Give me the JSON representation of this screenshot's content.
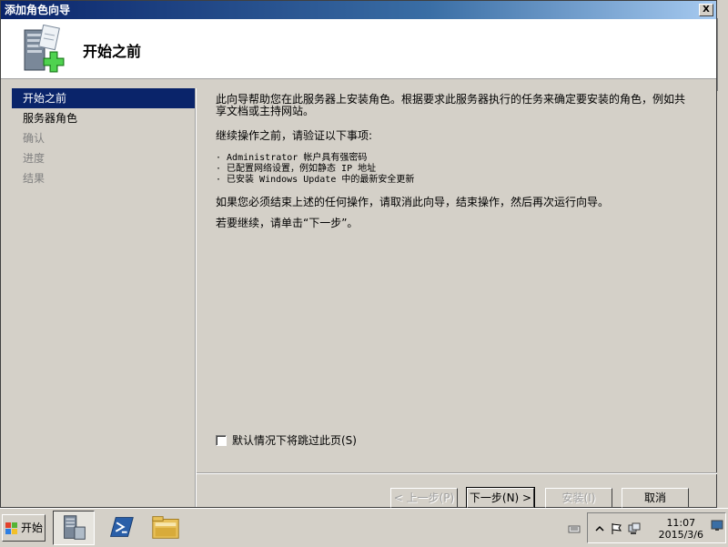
{
  "window": {
    "title": "添加角色向导",
    "close_label": "X"
  },
  "header": {
    "title": "开始之前",
    "icon": "server-add-icon"
  },
  "nav": {
    "items": [
      {
        "label": "开始之前",
        "state": "active"
      },
      {
        "label": "服务器角色",
        "state": "enabled"
      },
      {
        "label": "确认",
        "state": "disabled"
      },
      {
        "label": "进度",
        "state": "disabled"
      },
      {
        "label": "结果",
        "state": "disabled"
      }
    ]
  },
  "content": {
    "intro_line1": "此向导帮助您在此服务器上安装角色。根据要求此服务器执行的任务来确定要安装的角色，例如共",
    "intro_line2": "享文档或主持网站。",
    "verify_heading": "继续操作之前，请验证以下事项:",
    "bullets": [
      "· Administrator 帐户具有强密码",
      "· 已配置网络设置，例如静态 IP 地址",
      "· 已安装 Windows Update 中的最新安全更新"
    ],
    "cancel_note": "如果您必须结束上述的任何操作，请取消此向导，结束操作，然后再次运行向导。",
    "continue_note": "若要继续，请单击“下一步”。"
  },
  "skip_checkbox": {
    "label": "默认情况下将跳过此页(S)",
    "checked": false
  },
  "buttons": {
    "prev": "< 上一步(P)",
    "next": "下一步(N) >",
    "install": "安装(I)",
    "cancel": "取消"
  },
  "taskbar": {
    "start_label": "开始",
    "apps": [
      "server-manager-icon",
      "powershell-icon",
      "explorer-folder-icon"
    ],
    "tray_icons": [
      "keyboard-icon",
      "show-hidden-icons-chevron",
      "action-center-flag-icon",
      "network-icon"
    ],
    "time": "11:07",
    "date": "2015/3/6"
  },
  "colors": {
    "selection": "#0a246a",
    "face": "#d4d0c8",
    "disabled_text": "#808080"
  }
}
